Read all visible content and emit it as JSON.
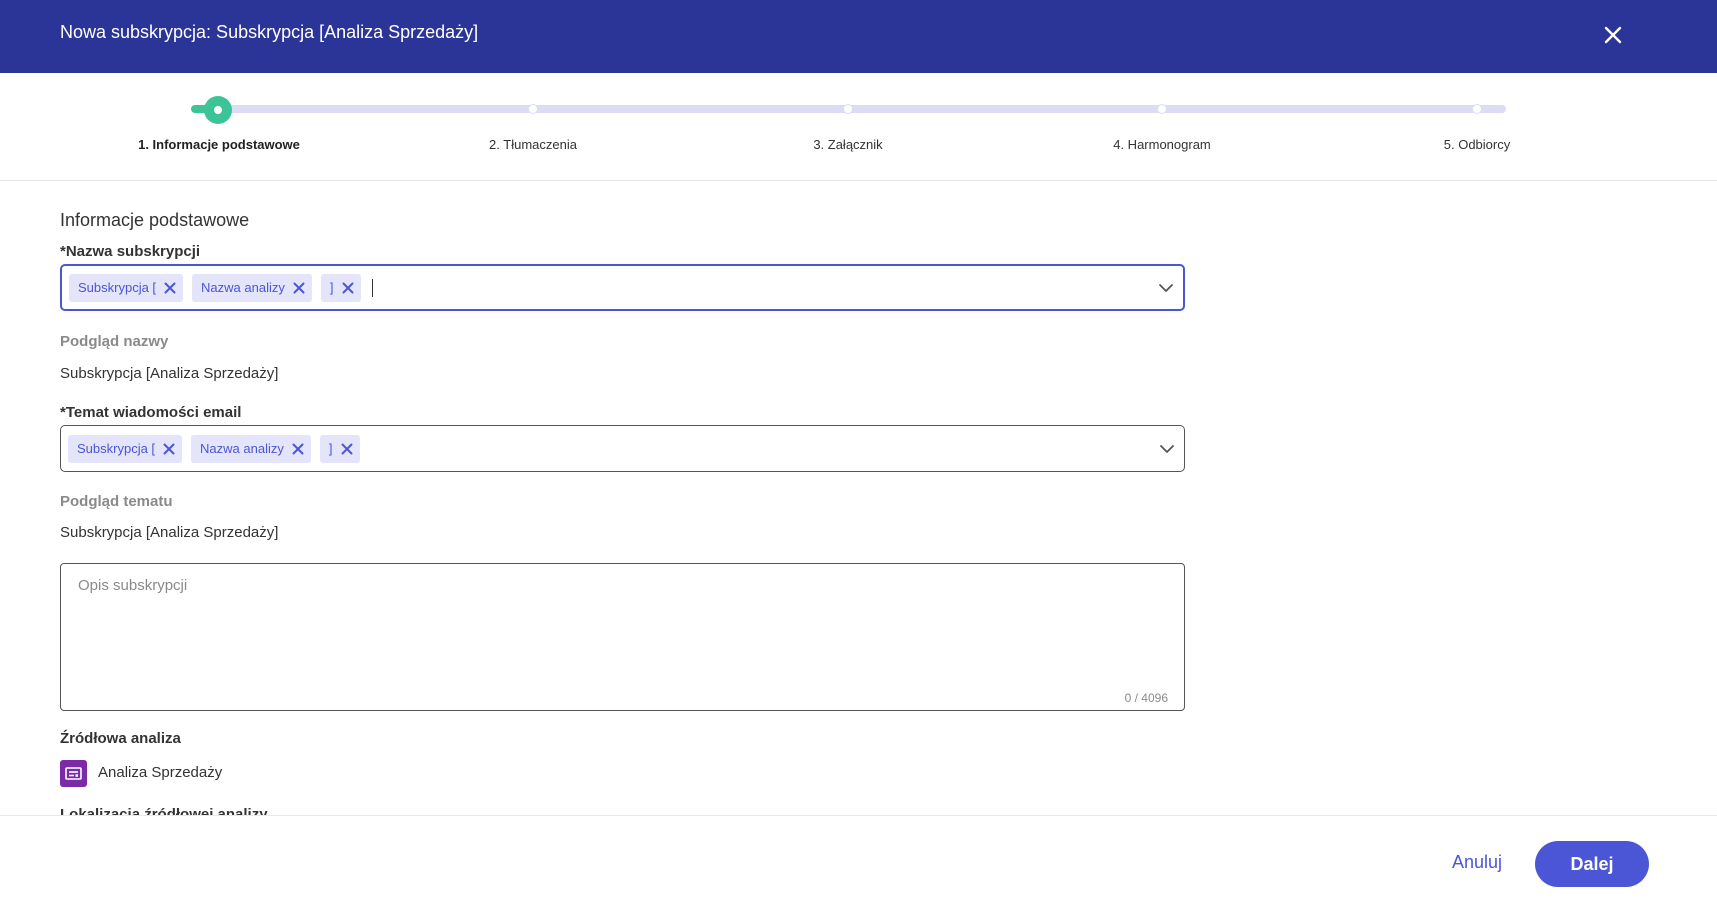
{
  "dialog": {
    "title": "Nowa subskrypcja: Subskrypcja [Analiza Sprzedaży]",
    "close_icon": "close-icon"
  },
  "stepper": {
    "current_step": 1,
    "steps": [
      {
        "label": "1. Informacje podstawowe"
      },
      {
        "label": "2. Tłumaczenia"
      },
      {
        "label": "3. Załącznik"
      },
      {
        "label": "4. Harmonogram"
      },
      {
        "label": "5. Odbiorcy"
      }
    ]
  },
  "form": {
    "section_title": "Informacje podstawowe",
    "name_field": {
      "label": "*Nazwa subskrypcji",
      "tags": [
        "Subskrypcja [",
        "Nazwa analizy",
        "]"
      ]
    },
    "name_preview": {
      "label": "Podgląd nazwy",
      "value": "Subskrypcja [Analiza Sprzedaży]"
    },
    "subject_field": {
      "label": "*Temat wiadomości email",
      "tags": [
        "Subskrypcja [",
        "Nazwa analizy",
        "]"
      ]
    },
    "subject_preview": {
      "label": "Podgląd tematu",
      "value": "Subskrypcja [Analiza Sprzedaży]"
    },
    "description": {
      "placeholder": "Opis subskrypcji",
      "counter": "0 / 4096"
    },
    "source_analysis": {
      "label": "Źródłowa analiza",
      "name": "Analiza Sprzedaży",
      "icon": "analysis-icon"
    },
    "source_location_label": "Lokalizacja źródłowej analizy"
  },
  "footer": {
    "cancel_label": "Anuluj",
    "next_label": "Dalej"
  },
  "colors": {
    "header_bg": "#2b3597",
    "accent": "#4b56d6",
    "step_done": "#3cc496",
    "tag_bg": "#e4e4fb",
    "analysis_icon_bg": "#7b2aa8"
  }
}
